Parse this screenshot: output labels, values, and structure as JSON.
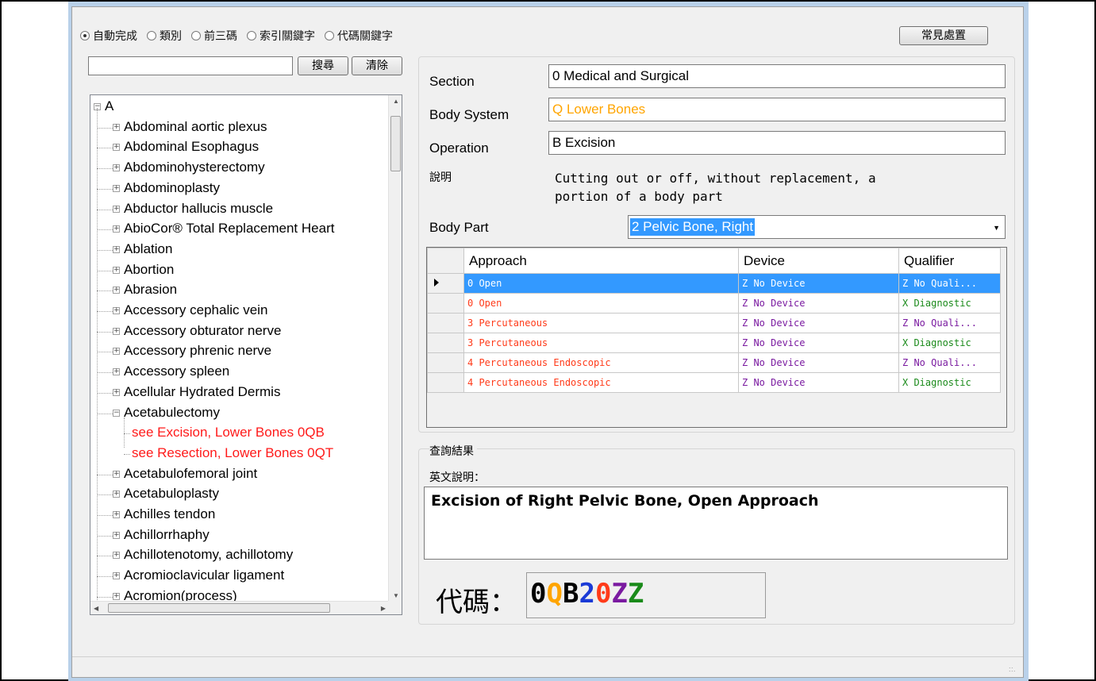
{
  "radio_options": [
    {
      "label": "自動完成",
      "checked": true
    },
    {
      "label": "類別",
      "checked": false
    },
    {
      "label": "前三碼",
      "checked": false
    },
    {
      "label": "索引關鍵字",
      "checked": false
    },
    {
      "label": "代碼關鍵字",
      "checked": false
    }
  ],
  "common_button": "常見處置",
  "search": {
    "value": "",
    "search_button": "搜尋",
    "clear_button": "清除"
  },
  "tree": {
    "root": "A",
    "items": [
      "Abdominal aortic plexus",
      "Abdominal Esophagus",
      "Abdominohysterectomy",
      "Abdominoplasty",
      "Abductor hallucis muscle",
      "AbioCor® Total Replacement Heart",
      "Ablation",
      "Abortion",
      "Abrasion",
      "Accessory cephalic vein",
      "Accessory obturator nerve",
      "Accessory phrenic nerve",
      "Accessory spleen",
      "Acellular Hydrated Dermis",
      "Acetabulectomy",
      "see Excision, Lower Bones 0QB",
      "see Resection, Lower Bones 0QT",
      "Acetabulofemoral joint",
      "Acetabuloplasty",
      "Achilles tendon",
      "Achillorrhaphy",
      "Achillotenotomy, achillotomy",
      "Acromioclavicular ligament",
      "Acromion(process)"
    ]
  },
  "fields": {
    "section_label": "Section",
    "section_value": "0 Medical and Surgical",
    "body_system_label": "Body System",
    "body_system_value": "Q Lower Bones",
    "operation_label": "Operation",
    "operation_value": "B Excision",
    "description_label": "說明",
    "description_line1": "Cutting out or off, without replacement, a",
    "description_line2": "portion of a body part",
    "body_part_label": "Body Part",
    "body_part_value": "2 Pelvic Bone, Right"
  },
  "grid": {
    "headers": [
      "Approach",
      "Device",
      "Qualifier"
    ],
    "rows": [
      {
        "approach": "0 Open",
        "device": "Z No Device",
        "qualifier": "Z No Quali..."
      },
      {
        "approach": "0 Open",
        "device": "Z No Device",
        "qualifier": "X Diagnostic"
      },
      {
        "approach": "3 Percutaneous",
        "device": "Z No Device",
        "qualifier": "Z No Quali..."
      },
      {
        "approach": "3 Percutaneous",
        "device": "Z No Device",
        "qualifier": "X Diagnostic"
      },
      {
        "approach": "4 Percutaneous Endoscopic",
        "device": "Z No Device",
        "qualifier": "Z No Quali..."
      },
      {
        "approach": "4 Percutaneous Endoscopic",
        "device": "Z No Device",
        "qualifier": "X Diagnostic"
      }
    ]
  },
  "result": {
    "group_title": "查詢結果",
    "english_label": "英文說明：",
    "english_text": "Excision of Right Pelvic Bone, Open Approach",
    "code_label": "代碼：",
    "code_chars": [
      "0",
      "Q",
      "B",
      "2",
      "0",
      "Z",
      "Z"
    ],
    "code_colors": [
      "#000000",
      "#ffa500",
      "#000000",
      "#1a3ad6",
      "#ff3b1a",
      "#7a1aa0",
      "#1a8a1a"
    ]
  },
  "colors": {
    "body_system_text": "#ffa500",
    "selection": "#3399ff",
    "see_link": "#ff1a1a"
  }
}
